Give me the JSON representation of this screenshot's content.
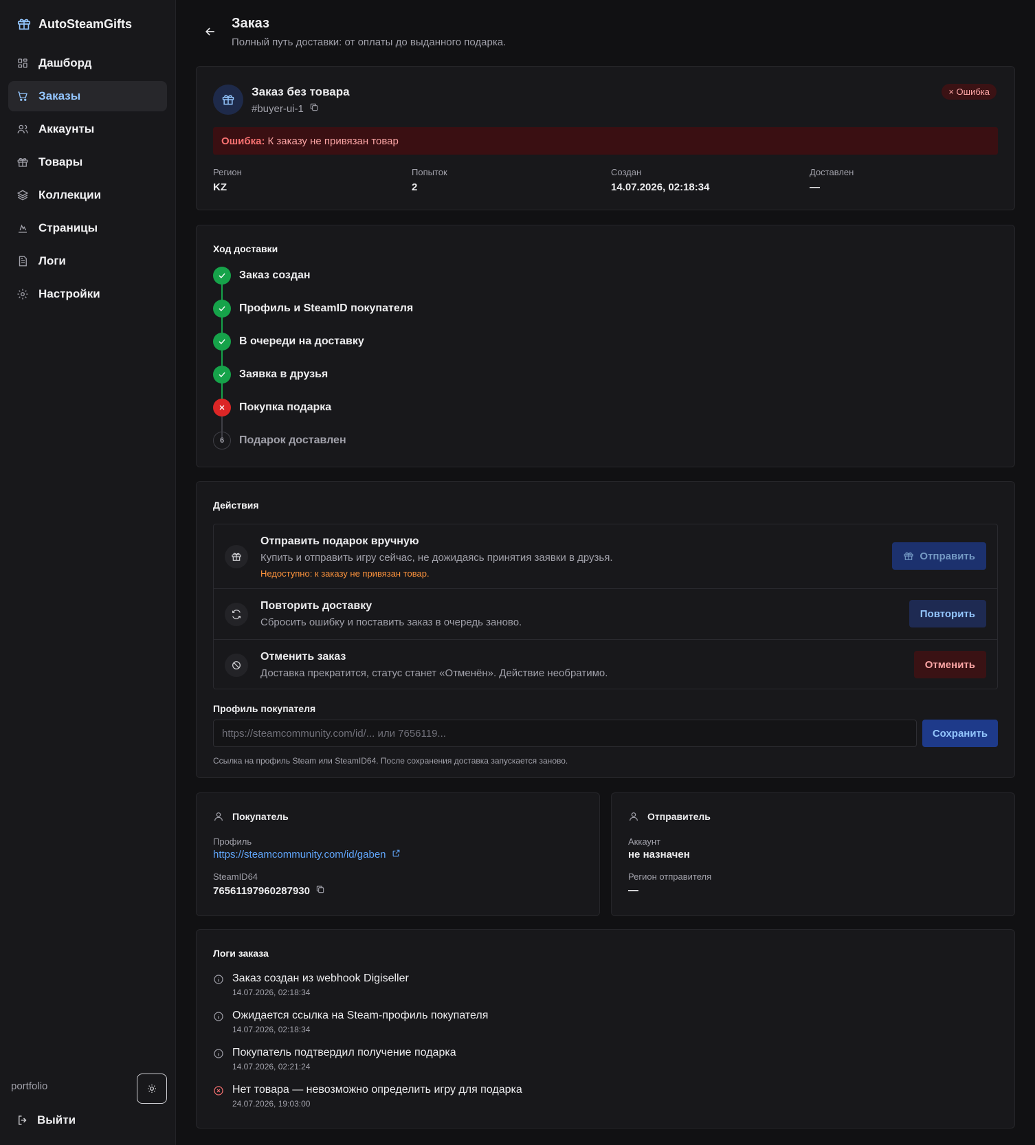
{
  "app": {
    "name": "AutoSteamGifts"
  },
  "sidebar": {
    "items": [
      {
        "label": "Дашборд",
        "icon": "dashboard-icon"
      },
      {
        "label": "Заказы",
        "icon": "cart-icon",
        "active": true
      },
      {
        "label": "Аккаунты",
        "icon": "users-icon"
      },
      {
        "label": "Товары",
        "icon": "gift-icon"
      },
      {
        "label": "Коллекции",
        "icon": "layers-icon"
      },
      {
        "label": "Страницы",
        "icon": "pages-icon"
      },
      {
        "label": "Логи",
        "icon": "file-icon"
      },
      {
        "label": "Настройки",
        "icon": "gear-icon"
      }
    ],
    "workspace": "portfolio",
    "logout": "Выйти"
  },
  "header": {
    "title": "Заказ",
    "subtitle": "Полный путь доставки: от оплаты до выданного подарка."
  },
  "order": {
    "name": "Заказ без товара",
    "id": "#buyer-ui-1",
    "status": "Ошибка",
    "status_prefix": "×",
    "error_label": "Ошибка:",
    "error_text": "К заказу не привязан товар",
    "meta": [
      {
        "label": "Регион",
        "value": "KZ"
      },
      {
        "label": "Попыток",
        "value": "2"
      },
      {
        "label": "Создан",
        "value": "14.07.2026, 02:18:34"
      },
      {
        "label": "Доставлен",
        "value": "—"
      }
    ]
  },
  "progress": {
    "title": "Ход доставки",
    "steps": [
      {
        "label": "Заказ создан",
        "state": "done"
      },
      {
        "label": "Профиль и SteamID покупателя",
        "state": "done"
      },
      {
        "label": "В очереди на доставку",
        "state": "done"
      },
      {
        "label": "Заявка в друзья",
        "state": "done"
      },
      {
        "label": "Покупка подарка",
        "state": "failed"
      },
      {
        "label": "Подарок доставлен",
        "state": "pending",
        "number": "6"
      }
    ]
  },
  "actions": {
    "title": "Действия",
    "items": [
      {
        "title": "Отправить подарок вручную",
        "desc": "Купить и отправить игру сейчас, не дожидаясь принятия заявки в друзья.",
        "warning": "Недоступно: к заказу не привязан товар.",
        "button": "Отправить"
      },
      {
        "title": "Повторить доставку",
        "desc": "Сбросить ошибку и поставить заказ в очередь заново.",
        "button": "Повторить"
      },
      {
        "title": "Отменить заказ",
        "desc": "Доставка прекратится, статус станет «Отменён». Действие необратимо.",
        "button": "Отменить"
      }
    ],
    "profile": {
      "label": "Профиль покупателя",
      "placeholder": "https://steamcommunity.com/id/... или 7656119...",
      "value": "",
      "button": "Сохранить",
      "hint": "Ссылка на профиль Steam или SteamID64. После сохранения доставка запускается заново."
    }
  },
  "buyer": {
    "title": "Покупатель",
    "profile_label": "Профиль",
    "profile_url": "https://steamcommunity.com/id/gaben",
    "steamid_label": "SteamID64",
    "steamid": "76561197960287930"
  },
  "sender": {
    "title": "Отправитель",
    "account_label": "Аккаунт",
    "account": "не назначен",
    "region_label": "Регион отправителя",
    "region": "—"
  },
  "logs": {
    "title": "Логи заказа",
    "entries": [
      {
        "message": "Заказ создан из webhook Digiseller",
        "time": "14.07.2026, 02:18:34",
        "level": "info"
      },
      {
        "message": "Ожидается ссылка на Steam-профиль покупателя",
        "time": "14.07.2026, 02:18:34",
        "level": "info"
      },
      {
        "message": "Покупатель подтвердил получение подарка",
        "time": "14.07.2026, 02:21:24",
        "level": "info"
      },
      {
        "message": "Нет товара — невозможно определить игру для подарка",
        "time": "24.07.2026, 19:03:00",
        "level": "error"
      }
    ]
  },
  "colors": {
    "accent": "#93c5fd",
    "success": "#16a34a",
    "danger": "#dc2626",
    "warning": "#fb923c"
  }
}
